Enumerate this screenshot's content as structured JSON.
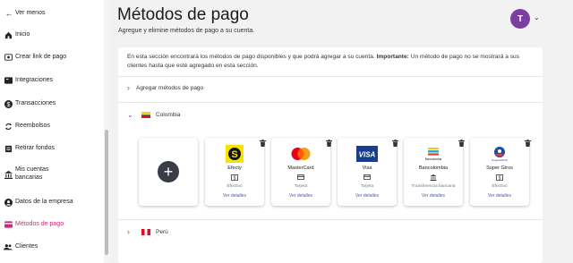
{
  "sidebar": {
    "back_label": "Ver menos",
    "items": [
      {
        "label": "Inicio",
        "icon": "home-icon"
      },
      {
        "label": "Crear link de pago",
        "icon": "payment-link-icon"
      },
      {
        "label": "Integraciones",
        "icon": "integrations-icon"
      },
      {
        "label": "Transacciones",
        "icon": "transactions-icon"
      },
      {
        "label": "Reembolsos",
        "icon": "refunds-icon"
      },
      {
        "label": "Retirar fondos",
        "icon": "withdraw-icon"
      },
      {
        "label": "Mis cuentas",
        "label2": "bancarias",
        "icon": "bank-icon"
      },
      {
        "label": "Datos de la empresa",
        "icon": "company-icon"
      },
      {
        "label": "Métodos de pago",
        "icon": "payment-methods-icon",
        "active": true
      },
      {
        "label": "Clientes",
        "icon": "clients-icon"
      }
    ]
  },
  "header": {
    "title": "Métodos de pago",
    "subtitle": "Agregue y elimine métodos de pago a su cuenta.",
    "avatar_initial": "T"
  },
  "info": {
    "text_before": "En esta sección encontrará los métodos de pago disponibles y que podrá agregar a su cuenta. ",
    "bold": "Importante:",
    "text_after": " Un método de pago no se mostrará a sus clientes hasta que esté agregado en esta sección."
  },
  "sections": {
    "add_methods_label": "Agregar métodos de pago",
    "colombia_label": "Colombia",
    "peru_label": "Perú"
  },
  "payment_methods": [
    {
      "name": "Efecty",
      "type": "Efectivo",
      "type_icon": "cash-icon",
      "link": "Ver detalles"
    },
    {
      "name": "MasterCard",
      "type": "Tarjeta",
      "type_icon": "card-icon",
      "link": "Ver detalles"
    },
    {
      "name": "Visa",
      "type": "Tarjeta",
      "type_icon": "card-icon",
      "link": "Ver detalles",
      "logo_text": "VISA"
    },
    {
      "name": "Bancolombia",
      "type": "Transferencia bancaria",
      "type_icon": "bank-icon",
      "link": "Ver detalles",
      "logo_text": "Bancolombia"
    },
    {
      "name": "Super Giros",
      "type": "Efectivo",
      "type_icon": "cash-icon",
      "link": "Ver detalles",
      "logo_text": "SuperGIROS"
    }
  ],
  "colors": {
    "accent": "#d1267a",
    "avatar": "#7b3fa0",
    "link": "#4a58c6"
  }
}
